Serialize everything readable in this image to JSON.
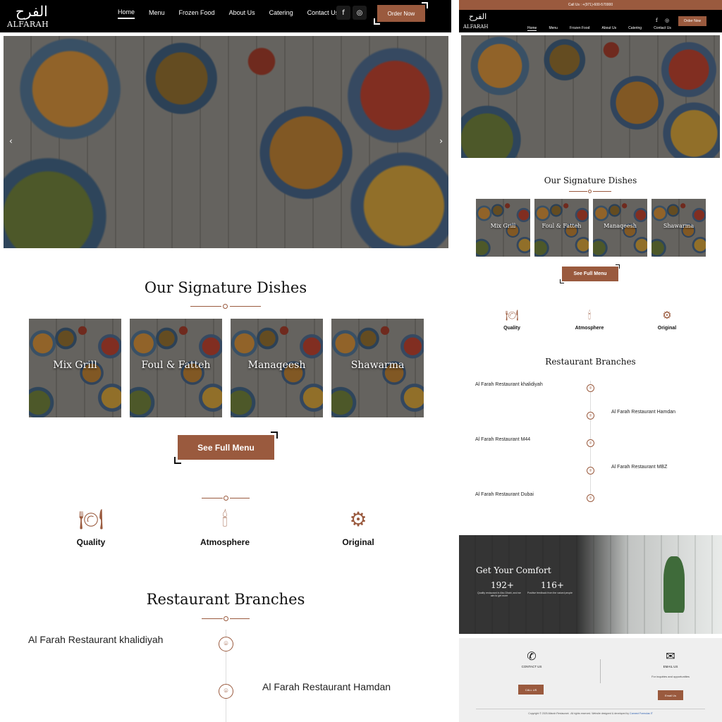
{
  "brand": {
    "logo_glyph": "الفرح",
    "logo_text": "ALFARAH"
  },
  "nav": {
    "items": [
      "Home",
      "Menu",
      "Frozen Food",
      "About Us",
      "Catering",
      "Contact Us"
    ],
    "order_label": "Order Now"
  },
  "topbar": {
    "call_text": "Call Us : +(971)-600-570000"
  },
  "hero": {
    "prev_icon": "chevron-left-icon",
    "next_icon": "chevron-right-icon"
  },
  "signature": {
    "title": "Our Signature Dishes",
    "dishes": [
      "Mix Grill",
      "Foul & Fatteh",
      "Manaqeesh",
      "Shawarma"
    ],
    "menu_button": "See Full Menu"
  },
  "features": [
    {
      "label": "Quality",
      "icon": "food-tray-icon"
    },
    {
      "label": "Atmosphere",
      "icon": "dining-table-icon"
    },
    {
      "label": "Original",
      "icon": "original-badge-icon"
    }
  ],
  "branches": {
    "title": "Restaurant Branches",
    "items": [
      "Al Farah Restaurant khalidiyah",
      "Al Farah Restaurant Hamdan",
      "Al Farah Restaurant M44",
      "Al Farah Restaurant MBZ",
      "Al Farah Restaurant Dubai"
    ]
  },
  "comfort": {
    "title": "Get Your Comfort",
    "stats": [
      {
        "value": "192+",
        "desc": "Quality restaurant in Abu Dhabi, and we aim to get more"
      },
      {
        "value": "116+",
        "desc": "Positive feedback from the valued people"
      }
    ]
  },
  "contact": {
    "phone_label": "CONTACT US",
    "phone_button": "CALL US",
    "email_label": "EMAIL US",
    "email_desc": "For inquiries and opportunities",
    "email_button": "Email Us",
    "copyright": "Copyright © 2025 Alfarah Restaurant . All rights reserved. Website designed & developed by",
    "developer": "Connect Formulas IT"
  },
  "colors": {
    "accent": "#9a5a3e",
    "header": "#000000"
  }
}
